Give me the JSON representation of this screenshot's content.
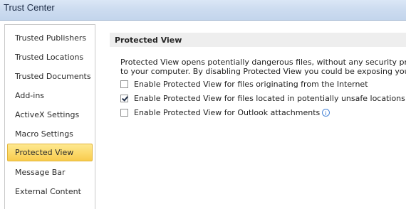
{
  "window": {
    "title": "Trust Center"
  },
  "sidebar": {
    "items": [
      {
        "label": "Trusted Publishers",
        "selected": false
      },
      {
        "label": "Trusted Locations",
        "selected": false
      },
      {
        "label": "Trusted Documents",
        "selected": false
      },
      {
        "label": "Add-ins",
        "selected": false
      },
      {
        "label": "ActiveX Settings",
        "selected": false
      },
      {
        "label": "Macro Settings",
        "selected": false
      },
      {
        "label": "Protected View",
        "selected": true
      },
      {
        "label": "Message Bar",
        "selected": false
      },
      {
        "label": "External Content",
        "selected": false
      }
    ]
  },
  "main": {
    "section_title": "Protected View",
    "description": [
      "Protected View opens potentially dangerous files, without any security prompt",
      "to your computer. By disabling Protected View you could be exposing your co"
    ],
    "options": [
      {
        "label": "Enable Protected View for files originating from the Internet",
        "checked": false,
        "info_icon": false
      },
      {
        "label": "Enable Protected View for files located in potentially unsafe locations",
        "checked": true,
        "info_icon": true
      },
      {
        "label": "Enable Protected View for Outlook attachments",
        "checked": false,
        "info_icon": true
      }
    ]
  },
  "colors": {
    "selected_item": "#fcdb6e",
    "section_header_bg": "#eeeeee",
    "info_icon": "#4a86d8"
  }
}
